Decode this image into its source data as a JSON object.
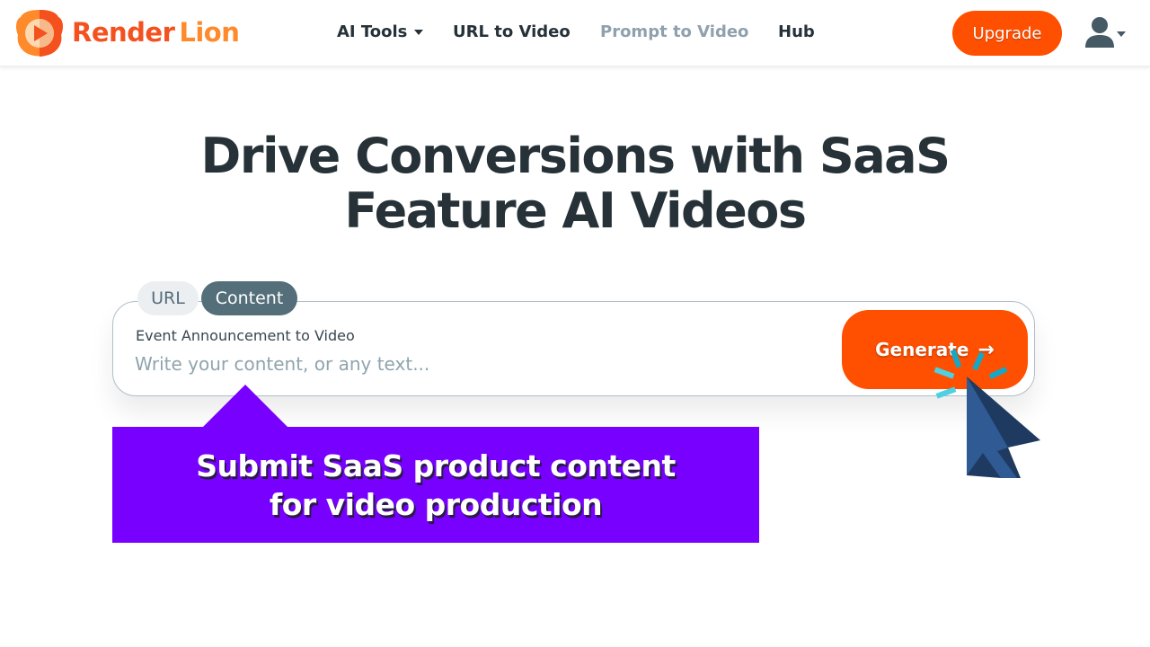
{
  "brand": {
    "name_part1": "Render",
    "name_part2": "Lion",
    "primary_color": "#f4511e",
    "secondary_color": "#ff8a2b"
  },
  "nav": {
    "items": [
      {
        "label": "AI Tools",
        "has_dropdown": true
      },
      {
        "label": "URL to Video"
      },
      {
        "label": "Prompt to Video",
        "state": "dimmed"
      },
      {
        "label": "Hub"
      }
    ],
    "upgrade_label": "Upgrade",
    "user_icon": "user-icon"
  },
  "hero": {
    "title_line1": "Drive Conversions with SaaS",
    "title_line2": "Feature AI Videos"
  },
  "input_panel": {
    "tabs": [
      {
        "label": "URL",
        "active": false
      },
      {
        "label": "Content",
        "active": true
      }
    ],
    "label": "Event Announcement to Video",
    "placeholder": "Write your content, or any text...",
    "value": "",
    "generate_label": "Generate",
    "generate_icon": "→"
  },
  "callout": {
    "line1": "Submit SaaS product content",
    "line2": "for video production",
    "color": "#7700ff"
  },
  "accent_color": "#ff4f00"
}
